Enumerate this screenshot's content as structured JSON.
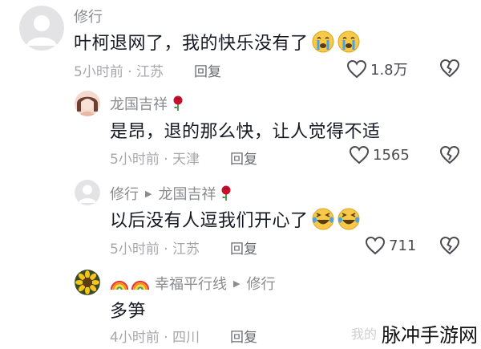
{
  "comments": [
    {
      "username": "修行",
      "text": "叶柯退网了，我的快乐没有了",
      "time_location": "5小时前 · 江苏",
      "reply_label": "回复",
      "likes": "1.8万",
      "avatar_icon": "default-avatar-icon",
      "emojis": [
        "crying-face",
        "crying-face"
      ]
    },
    {
      "username": "龙国吉祥",
      "text": "是昂，退的那么快，让人觉得不适",
      "time_location": "5小时前 · 天津",
      "reply_label": "回复",
      "likes": "1565",
      "avatar_icon": "photo-avatar-icon"
    },
    {
      "username": "修行",
      "reply_to": "龙国吉祥",
      "text": "以后没有人逗我们开心了",
      "time_location": "5小时前 · 江苏",
      "reply_label": "回复",
      "likes": "711",
      "avatar_icon": "default-avatar-icon",
      "emojis": [
        "laughing-tears-face",
        "laughing-tears-face"
      ]
    },
    {
      "username": "幸福平行线",
      "reply_to": "修行",
      "text": "多笋",
      "time_location": "4小时前 · 四川",
      "reply_label": "回复",
      "avatar_icon": "sunflower-avatar-icon"
    }
  ],
  "watermark": "脉冲手游网",
  "watermark_faded": "我的",
  "colors": {
    "text_primary": "#161823",
    "text_secondary": "#8a8b91",
    "meta": "#a7a7ab",
    "rose": "#c8102e"
  }
}
